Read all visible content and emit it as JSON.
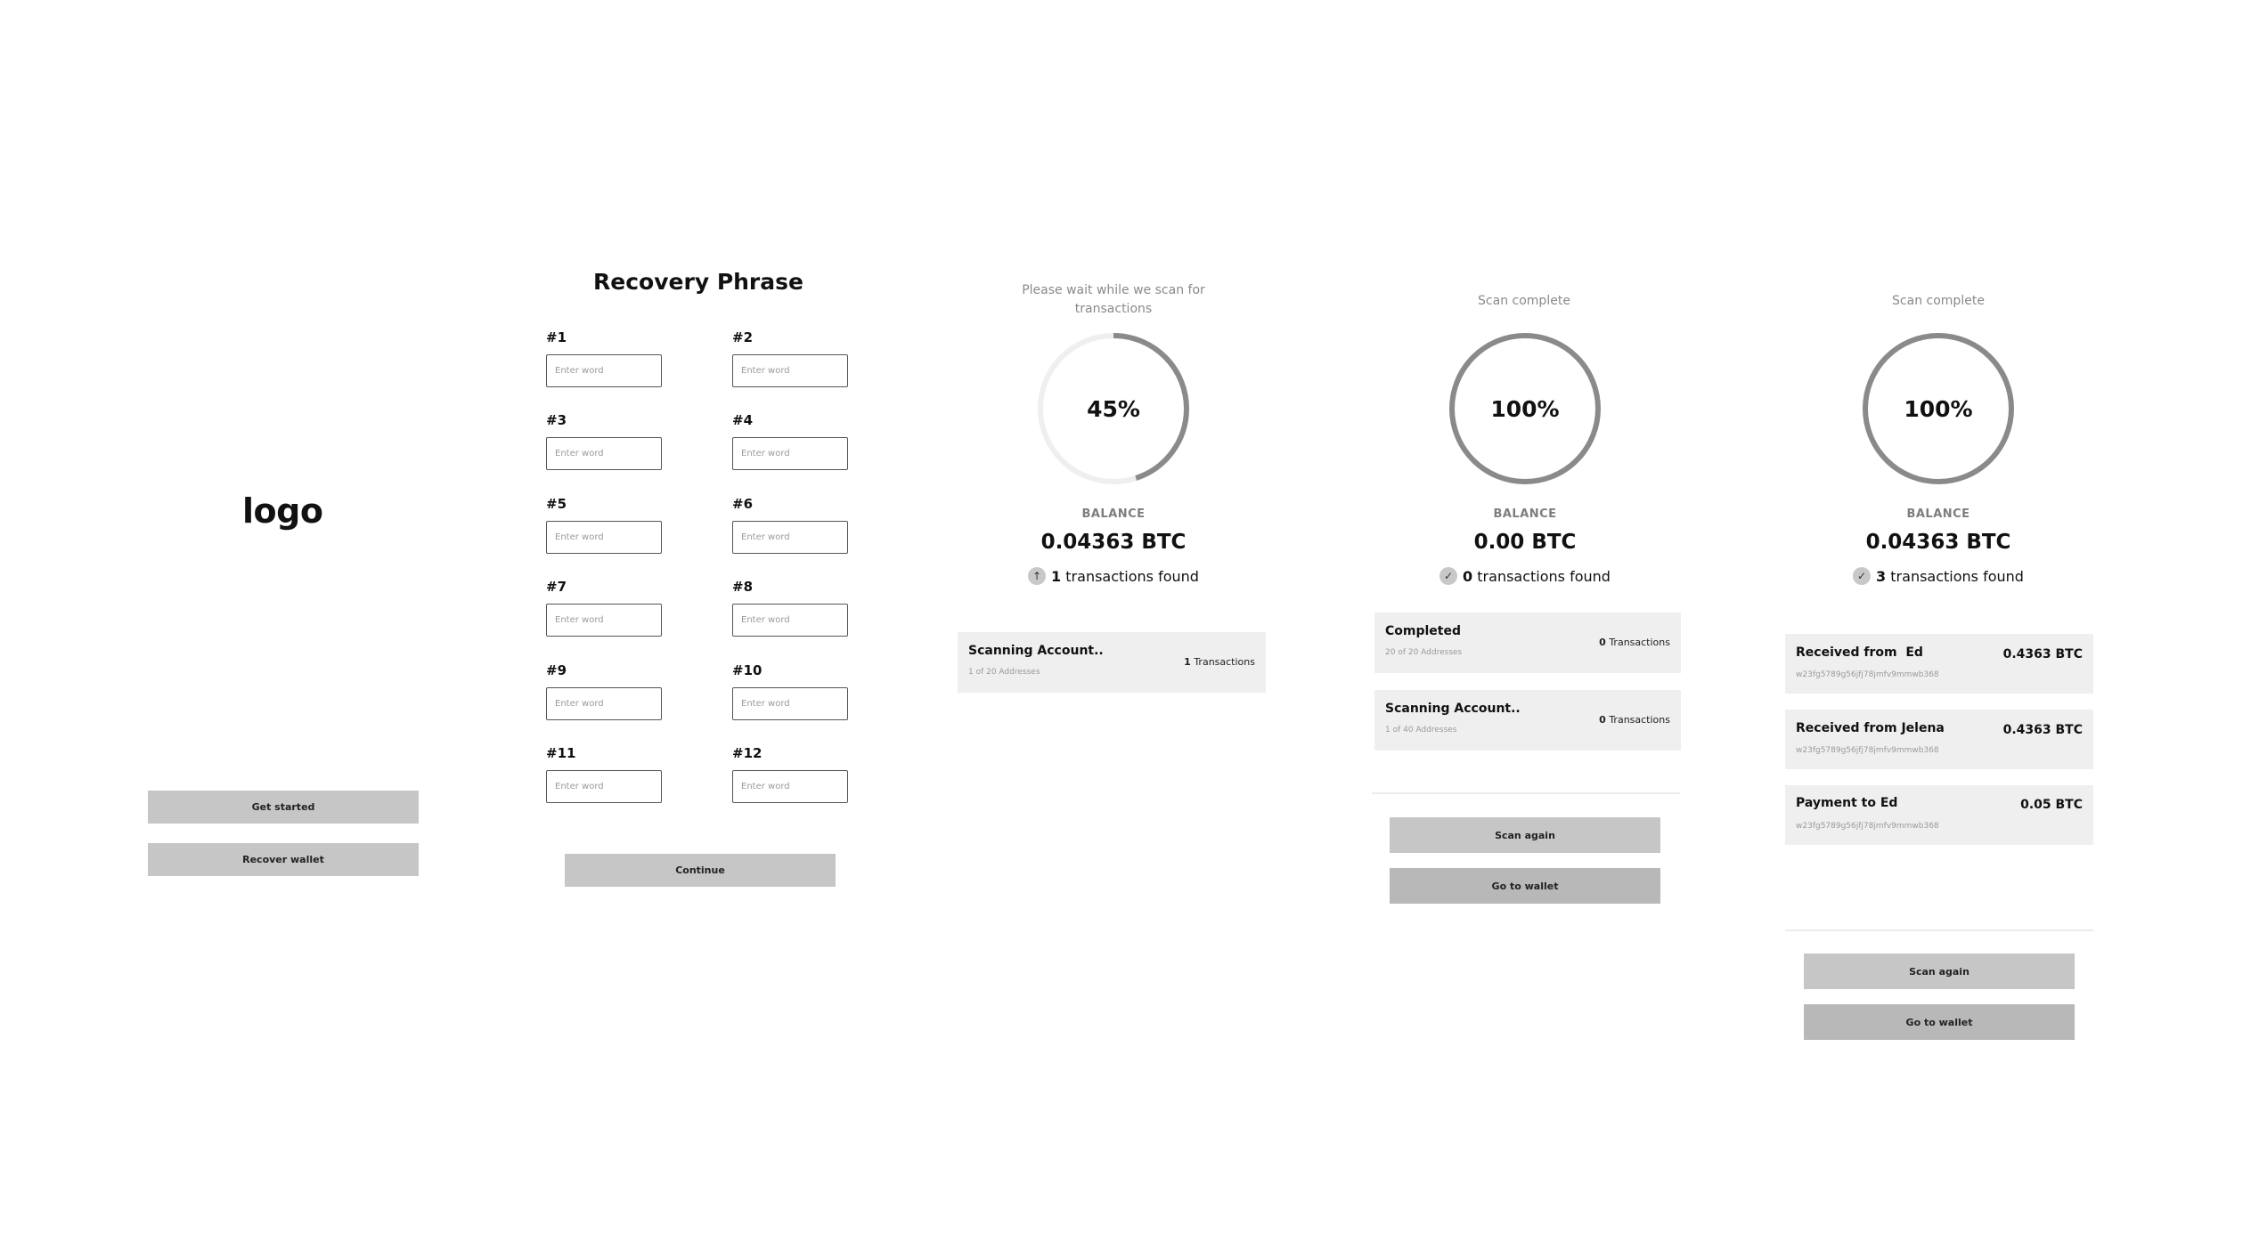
{
  "colors": {
    "button_bg": "#c6c6c6",
    "card_bg": "#efefef",
    "ring_progress": "#8a8a8a",
    "ring_track": "#efefef"
  },
  "welcome": {
    "logo": "logo",
    "get_started": "Get started",
    "recover_wallet": "Recover wallet"
  },
  "recovery": {
    "title": "Recovery Phrase",
    "placeholder": "Enter word",
    "labels": [
      "#1",
      "#2",
      "#3",
      "#4",
      "#5",
      "#6",
      "#7",
      "#8",
      "#9",
      "#10",
      "#11",
      "#12"
    ],
    "continue": "Continue"
  },
  "scanning": {
    "message": "Please wait while we scan for transactions",
    "progress_percent": 45,
    "progress_label": "45%",
    "balance_label": "BALANCE",
    "balance": "0.04363 BTC",
    "tx_count": "1",
    "tx_suffix": "transactions found",
    "tx_icon": "arrow-up-icon",
    "account": {
      "title": "Scanning Account..",
      "sub": "1 of 20 Addresses",
      "count": "1",
      "count_suffix": "Transactions"
    }
  },
  "complete_empty": {
    "message": "Scan complete",
    "progress_percent": 100,
    "progress_label": "100%",
    "balance_label": "BALANCE",
    "balance": "0.00 BTC",
    "tx_count": "0",
    "tx_suffix": "transactions found",
    "tx_icon": "check-icon",
    "accounts": [
      {
        "title": "Completed",
        "sub": "20 of 20 Addresses",
        "count": "0",
        "count_suffix": "Transactions"
      },
      {
        "title": "Scanning Account..",
        "sub": "1 of 40 Addresses",
        "count": "0",
        "count_suffix": "Transactions"
      }
    ],
    "scan_again": "Scan again",
    "go_to_wallet": "Go to wallet"
  },
  "complete_found": {
    "message": "Scan complete",
    "progress_percent": 100,
    "progress_label": "100%",
    "balance_label": "BALANCE",
    "balance": "0.04363 BTC",
    "tx_count": "3",
    "tx_suffix": "transactions found",
    "tx_icon": "check-icon",
    "transactions": [
      {
        "title": "Received from  Ed",
        "address": "w23fg5789g56jfj78jmfv9mmwb368",
        "amount": "0.4363 BTC"
      },
      {
        "title": "Received from Jelena",
        "address": "w23fg5789g56jfj78jmfv9mmwb368",
        "amount": "0.4363 BTC"
      },
      {
        "title": "Payment to Ed",
        "address": "w23fg5789g56jfj78jmfv9mmwb368",
        "amount": "0.05 BTC"
      }
    ],
    "scan_again": "Scan again",
    "go_to_wallet": "Go to wallet"
  }
}
